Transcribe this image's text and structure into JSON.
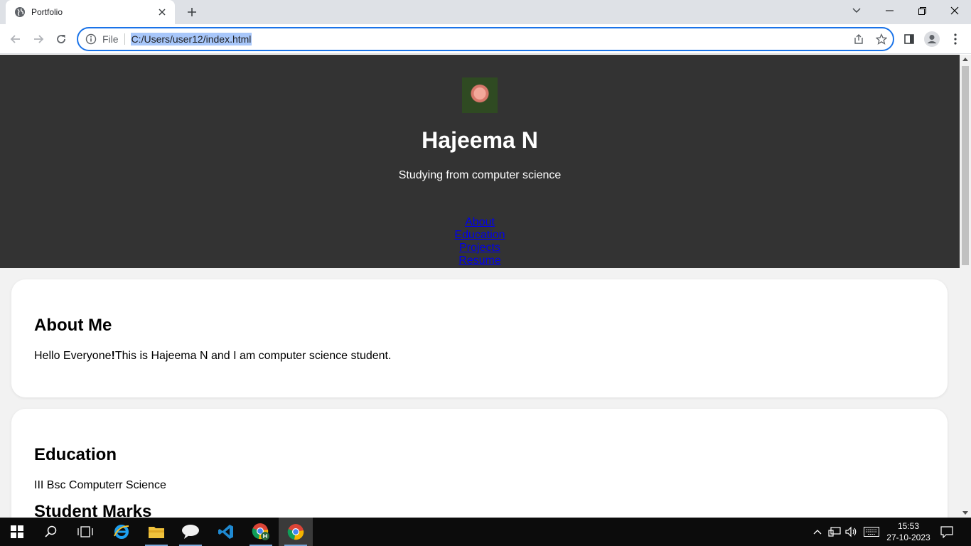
{
  "browser": {
    "tab_title": "Portfolio",
    "address_scheme_label": "File",
    "address_url": "C:/Users/user12/index.html"
  },
  "page": {
    "header": {
      "name": "Hajeema N",
      "tagline": "Studying from computer science",
      "nav": [
        "About",
        "Education",
        "Projects",
        "Resume"
      ]
    },
    "about": {
      "heading": "About Me",
      "text_prefix": "Hello Everyone",
      "text_mark": "!",
      "text_suffix": "This is Hajeema N and I am computer science student."
    },
    "education": {
      "heading": "Education",
      "text": "III Bsc Computerr Science",
      "subheading": "Student Marks"
    }
  },
  "taskbar": {
    "time": "15:53",
    "date": "27-10-2023"
  },
  "colors": {
    "header_bg": "#333333",
    "page_bg": "#f2f2f2",
    "link": "#0000ee",
    "omnibox_focus": "#1a73e8"
  }
}
